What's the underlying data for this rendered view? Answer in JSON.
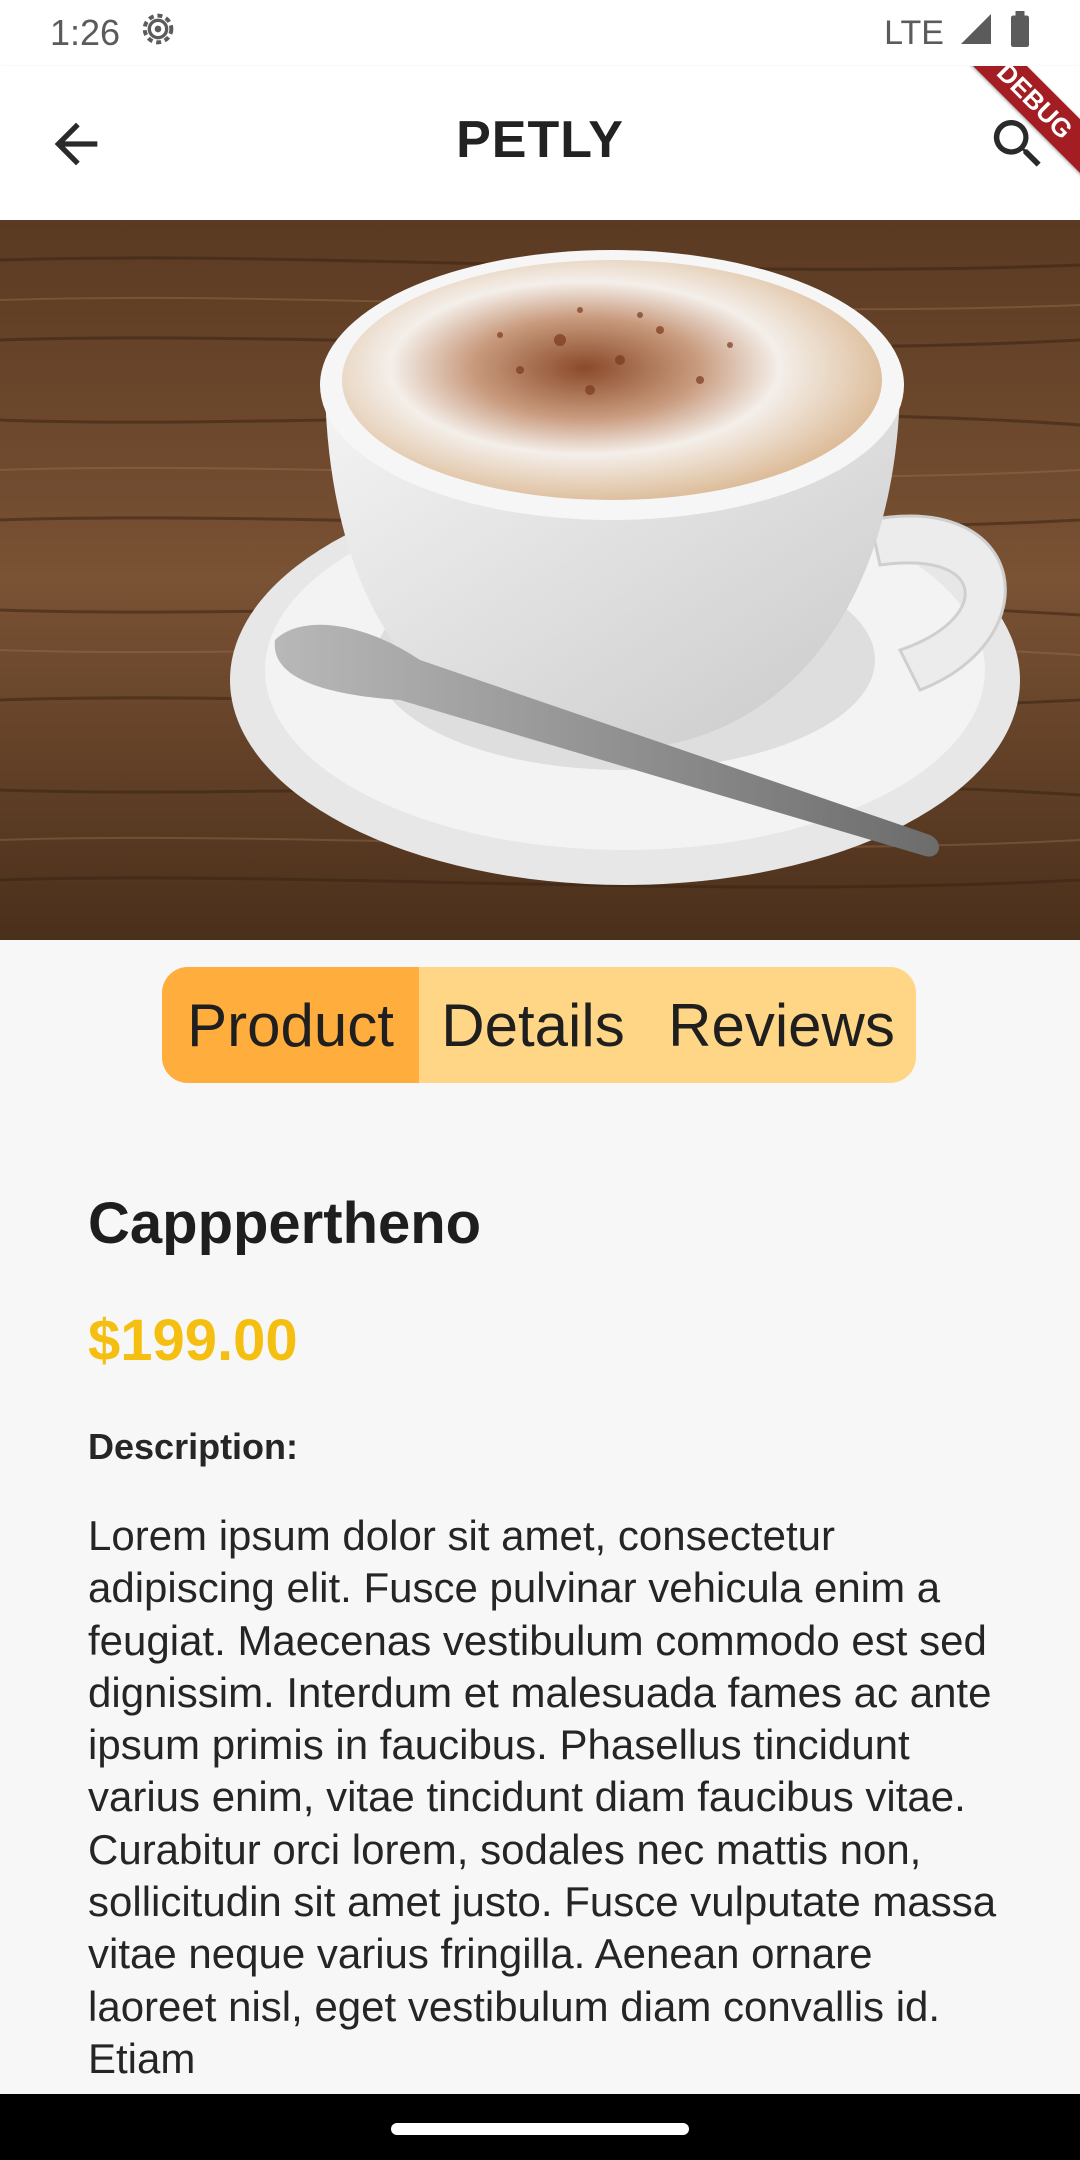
{
  "status_bar": {
    "time": "1:26",
    "network": "LTE",
    "icons": [
      "settings-icon",
      "signal-icon",
      "battery-icon"
    ]
  },
  "app_bar": {
    "title": "PETLY",
    "debug_label": "DEBUG",
    "icons": [
      "back-arrow-icon",
      "search-icon"
    ]
  },
  "hero": {
    "image": "cappuccino-cup-on-saucer-with-spoon-on-wooden-table"
  },
  "tabs": [
    {
      "label": "Product",
      "active": true
    },
    {
      "label": "Details",
      "active": false
    },
    {
      "label": "Reviews",
      "active": false
    }
  ],
  "product": {
    "name": "Capppertheno",
    "price": "$199.00",
    "description_label": "Description:",
    "description": "Lorem ipsum dolor sit amet, consectetur adipiscing elit. Fusce pulvinar vehicula enim a feugiat. Maecenas vestibulum commodo est sed dignissim. Interdum et malesuada fames ac ante ipsum primis in faucibus. Phasellus tincidunt varius enim, vitae tincidunt diam faucibus vitae. Curabitur orci lorem, sodales nec mattis non, sollicitudin sit amet justo. Fusce vulputate massa vitae neque varius fringilla. Aenean ornare laoreet nisl, eget vestibulum diam convallis id. Etiam"
  },
  "colors": {
    "tab_active": "#ffad3d",
    "tab_inactive": "#ffd686",
    "price": "#f5bf12",
    "debug_ribbon": "#a31d22"
  }
}
